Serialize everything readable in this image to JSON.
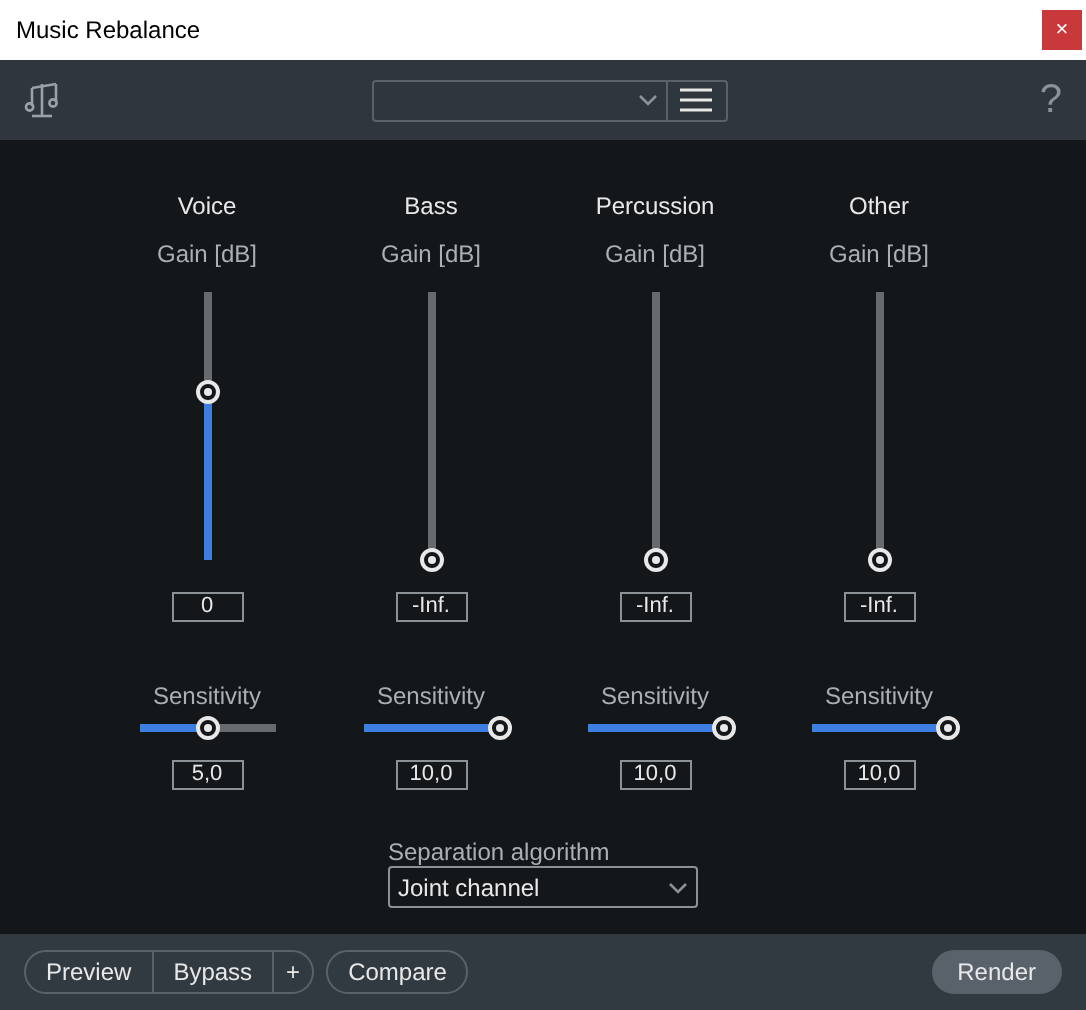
{
  "window": {
    "title": "Music Rebalance",
    "close": "×"
  },
  "toolbar": {
    "help": "?"
  },
  "channels": [
    {
      "name": "Voice",
      "gain": {
        "label": "Gain [dB]",
        "level": 0.63,
        "value": "0"
      },
      "sensitivity": {
        "label": "Sensitivity",
        "level": 0.5,
        "value": "5,0"
      }
    },
    {
      "name": "Bass",
      "gain": {
        "label": "Gain [dB]",
        "level": 0,
        "value": "-Inf."
      },
      "sensitivity": {
        "label": "Sensitivity",
        "level": 1,
        "value": "10,0"
      }
    },
    {
      "name": "Percussion",
      "gain": {
        "label": "Gain [dB]",
        "level": 0,
        "value": "-Inf."
      },
      "sensitivity": {
        "label": "Sensitivity",
        "level": 1,
        "value": "10,0"
      }
    },
    {
      "name": "Other",
      "gain": {
        "label": "Gain [dB]",
        "level": 0,
        "value": "-Inf."
      },
      "sensitivity": {
        "label": "Sensitivity",
        "level": 1,
        "value": "10,0"
      }
    }
  ],
  "separation": {
    "label": "Separation algorithm",
    "value": "Joint channel"
  },
  "footer": {
    "group": [
      "Preview",
      "Bypass",
      "+"
    ],
    "compare": "Compare",
    "render": "Render"
  }
}
